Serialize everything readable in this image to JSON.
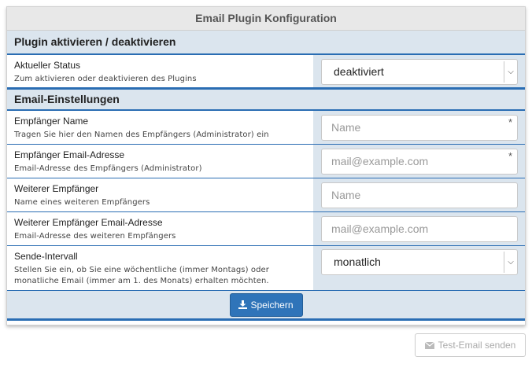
{
  "panel": {
    "title": "Email Plugin Konfiguration"
  },
  "section_activation": {
    "heading": "Plugin aktivieren / deaktivieren",
    "status": {
      "label": "Aktueller Status",
      "description": "Zum aktivieren oder deaktivieren des Plugins",
      "value": "deaktiviert"
    }
  },
  "section_email": {
    "heading": "Email-Einstellungen",
    "recipient_name": {
      "label": "Empfänger Name",
      "description": "Tragen Sie hier den Namen des Empfängers (Administrator) ein",
      "placeholder": "Name",
      "required_mark": "*"
    },
    "recipient_email": {
      "label": "Empfänger Email-Adresse",
      "description": "Email-Adresse des Empfängers (Administrator)",
      "placeholder": "mail@example.com",
      "required_mark": "*"
    },
    "extra_recipient_name": {
      "label": "Weiterer Empfänger",
      "description": "Name eines weiteren Empfängers",
      "placeholder": "Name"
    },
    "extra_recipient_email": {
      "label": "Weiterer Empfänger Email-Adresse",
      "description": "Email-Adresse des weiteren Empfängers",
      "placeholder": "mail@example.com"
    },
    "interval": {
      "label": "Sende-Intervall",
      "description": "Stellen Sie ein, ob Sie eine wöchentliche (immer Montags) oder monatliche Email (immer am 1. des Monats) erhalten möchten.",
      "value": "monatlich"
    }
  },
  "buttons": {
    "save_label": "Speichern",
    "save_icon": "download-icon",
    "test_label": "Test-Email senden",
    "test_icon": "envelope-icon"
  },
  "colors": {
    "accent": "#2a6db3",
    "section_bg": "#dbe5ee",
    "save_button": "#2f74b9"
  }
}
